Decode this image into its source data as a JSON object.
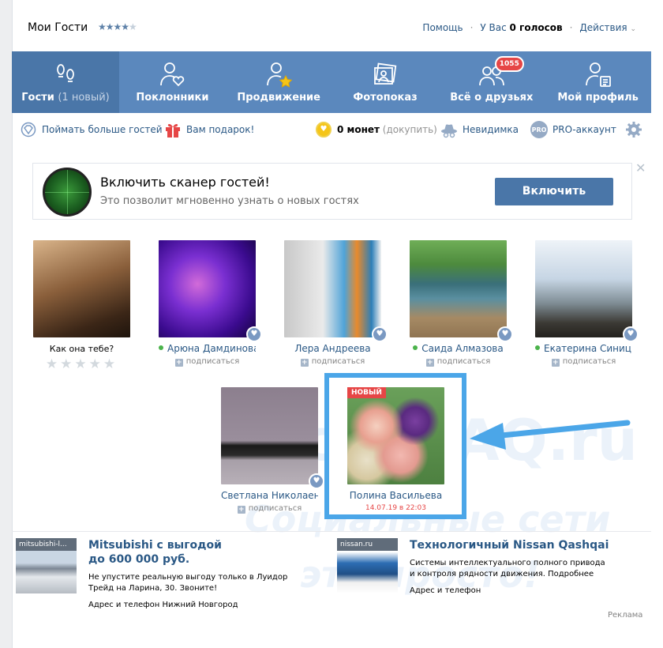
{
  "header": {
    "title": "Мои Гости",
    "help": "Помощь",
    "votes_prefix": "У Вас",
    "votes_value": "0 голосов",
    "actions": "Действия"
  },
  "nav": {
    "tabs": [
      {
        "label": "Гости",
        "sub": "(1 новый)",
        "icon": "footprints-icon",
        "active": true
      },
      {
        "label": "Поклонники",
        "icon": "fan-heart-icon"
      },
      {
        "label": "Продвижение",
        "icon": "promotion-star-icon"
      },
      {
        "label": "Фотопоказ",
        "icon": "photos-icon"
      },
      {
        "label": "Всё о друзьях",
        "icon": "friends-icon",
        "badge": "1055"
      },
      {
        "label": "Мой профиль",
        "icon": "profile-icon"
      }
    ]
  },
  "actionbar": {
    "more_guests": "Поймать больше гостей",
    "gift": "Вам подарок!",
    "coins_value": "0 монет",
    "coins_buy": "(докупить)",
    "invisible": "Невидимка",
    "pro_badge": "PRO",
    "pro": "PRO-аккаунт"
  },
  "promo": {
    "title": "Включить сканер гостей!",
    "desc": "Это позволит мгновенно узнать о новых гостях",
    "button": "Включить"
  },
  "guests": {
    "question": "Как она тебе?",
    "subscribe": "подписаться",
    "new_badge": "НОВЫЙ",
    "items": [
      {
        "name": "Арюна Дамдинова"
      },
      {
        "name": "Лера Андреева"
      },
      {
        "name": "Саида Алмазова"
      },
      {
        "name": "Екатерина Синиц..."
      },
      {
        "name": "Светлана Николаенко"
      },
      {
        "name": "Полина Васильева",
        "date": "14.07.19 в 22:03"
      }
    ]
  },
  "watermark": {
    "line1": "SocialBAQ.ru",
    "line2": "Социальные сети",
    "line3": "это просто!"
  },
  "ads": {
    "items": [
      {
        "label": "mitsubishi-l...",
        "title1": "Mitsubishi с выгодой",
        "title2": "до 600 000 руб.",
        "desc": "Не упустите реальную выгоду только в Луидор Трейд на Ларина, 30. Звоните!",
        "footer": "Адрес и телефон    Нижний Новгород"
      },
      {
        "label": "nissan.ru",
        "title1": "Технологичный Nissan Qashqai",
        "desc": "Системы интеллектуального полного привода и контроля рядности движения. Подробнее",
        "footer": "Адрес и телефон"
      }
    ],
    "reklama": "Реклама"
  }
}
